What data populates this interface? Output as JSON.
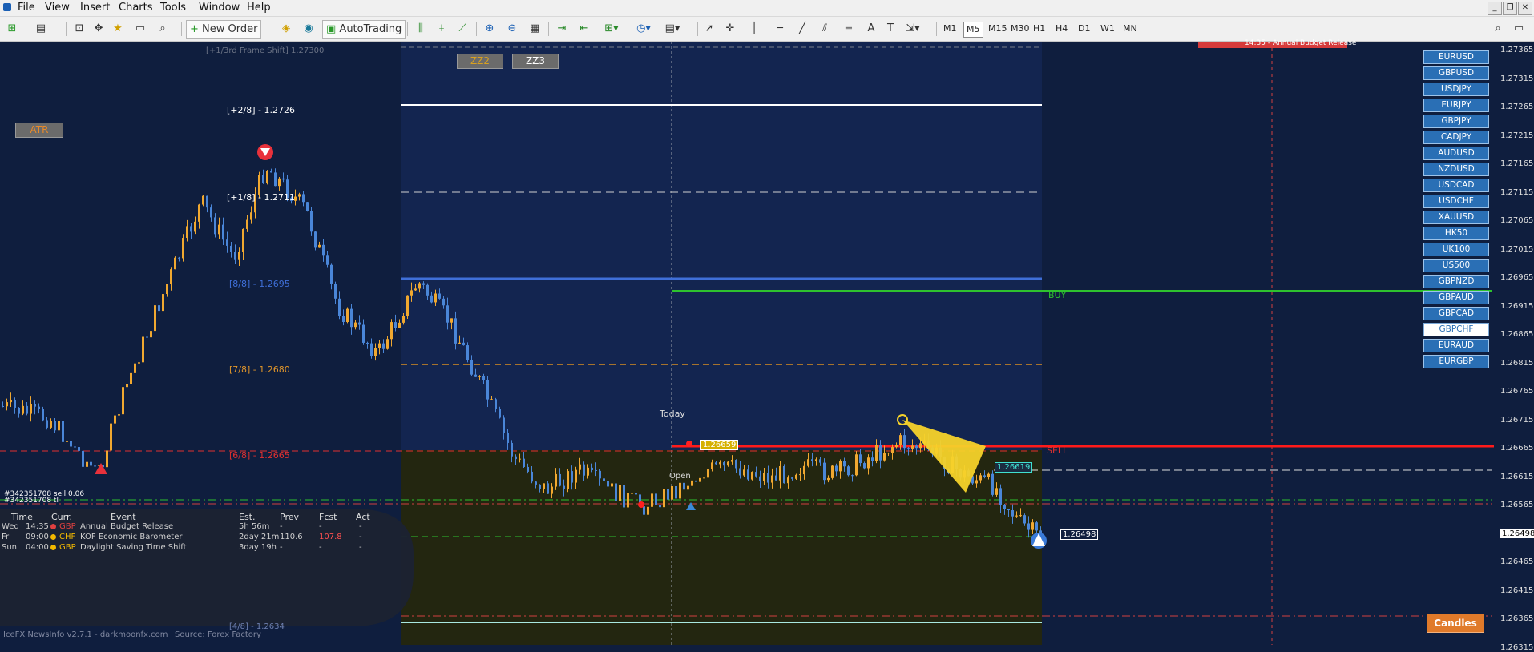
{
  "menu": [
    "File",
    "View",
    "Insert",
    "Charts",
    "Tools",
    "Window",
    "Help"
  ],
  "toolbar": {
    "new_order": "New Order",
    "autotrading": "AutoTrading"
  },
  "timeframes": [
    {
      "label": "M1",
      "active": false
    },
    {
      "label": "M5",
      "active": true
    },
    {
      "label": "M15",
      "active": false
    },
    {
      "label": "M30",
      "active": false
    },
    {
      "label": "H1",
      "active": false
    },
    {
      "label": "H4",
      "active": false
    },
    {
      "label": "D1",
      "active": false
    },
    {
      "label": "W1",
      "active": false
    },
    {
      "label": "MN",
      "active": false
    }
  ],
  "chart": {
    "frame_shift": "[+1/3rd Frame Shift]  1.27300",
    "zz2": "ZZ2",
    "zz3": "ZZ3",
    "atr": "ATR",
    "lvl_p28": "[+2/8] - 1.2726",
    "lvl_p18": "[+1/8] - 1.2711",
    "lvl_88": "[8/8] - 1.2695",
    "lvl_78": "[7/8] - 1.2680",
    "lvl_68": "[6/8] - 1.2665",
    "lvl_48": "[4/8] - 1.2634",
    "today": "Today",
    "open": "Open",
    "buy": "BUY",
    "sell": "SELL",
    "box_price_1": "1.26659",
    "box_price_2": "1.26619",
    "cur_price": "1.26498",
    "order_1": "#342351708 sell 0.06",
    "order_2": "#342351708 tl",
    "news_banner": "14:35 - Annual Budget Release",
    "candles_btn": "Candles",
    "footer_1": "IceFX NewsInfo v2.7.1 - darkmoonfx.com",
    "footer_2": "Source: Forex Factory"
  },
  "pairs": [
    "EURUSD",
    "GBPUSD",
    "USDJPY",
    "EURJPY",
    "GBPJPY",
    "CADJPY",
    "AUDUSD",
    "NZDUSD",
    "USDCAD",
    "USDCHF",
    "XAUUSD",
    "HK50",
    "UK100",
    "US500",
    "GBPNZD",
    "GBPAUD",
    "GBPCAD",
    "GBPCHF",
    "EURAUD",
    "EURGBP"
  ],
  "selected_pair": "GBPCHF",
  "price_axis": [
    "1.27365",
    "1.27315",
    "1.27265",
    "1.27215",
    "1.27165",
    "1.27115",
    "1.27065",
    "1.27015",
    "1.26965",
    "1.26915",
    "1.26865",
    "1.26815",
    "1.26765",
    "1.26715",
    "1.26665",
    "1.26615",
    "1.26565",
    "1.26515",
    "1.26498",
    "1.26465",
    "1.26415",
    "1.26365",
    "1.26315"
  ],
  "news": {
    "headers": {
      "time": "Time",
      "curr": "Curr.",
      "event": "Event",
      "est": "Est.",
      "prev": "Prev",
      "fcst": "Fcst",
      "act": "Act"
    },
    "rows": [
      {
        "day": "Wed",
        "time": "14:35",
        "color": "#e04040",
        "curr": "GBP",
        "event": "Annual Budget Release",
        "est": "5h 56m",
        "prev": "-",
        "fcst": "-",
        "act": "-"
      },
      {
        "day": "Fri",
        "time": "09:00",
        "color": "#f2b800",
        "curr": "CHF",
        "event": "KOF Economic Barometer",
        "est": "2day 21m",
        "prev": "110.6",
        "fcst": "107.8",
        "act": "-"
      },
      {
        "day": "Sun",
        "time": "04:00",
        "color": "#f2b800",
        "curr": "GBP",
        "event": "Daylight Saving Time Shift",
        "est": "3day 19h",
        "prev": "-",
        "fcst": "-",
        "act": "-"
      }
    ]
  }
}
